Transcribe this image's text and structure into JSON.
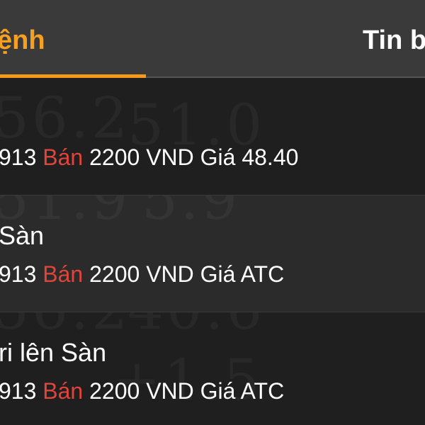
{
  "tabs": [
    {
      "label": "ệnh",
      "active": true
    },
    {
      "label": "Tin b",
      "active": false
    }
  ],
  "notifications": [
    {
      "title": "",
      "detail_prefix": "913 ",
      "detail_side": "Bán",
      "detail_suffix": " 2200 VND Giá 48.40"
    },
    {
      "title": "Sàn",
      "detail_prefix": "913 ",
      "detail_side": "Bán",
      "detail_suffix": " 2200 VND Giá ATC"
    },
    {
      "title": "ri lên Sàn",
      "detail_prefix": "913 ",
      "detail_side": "Bán",
      "detail_suffix": " 2200 VND Giá ATC"
    }
  ],
  "colors": {
    "accent": "#f5a023",
    "sell": "#e0443a",
    "tabbar": "#3a3a3a",
    "background": "#1b1b1b"
  }
}
